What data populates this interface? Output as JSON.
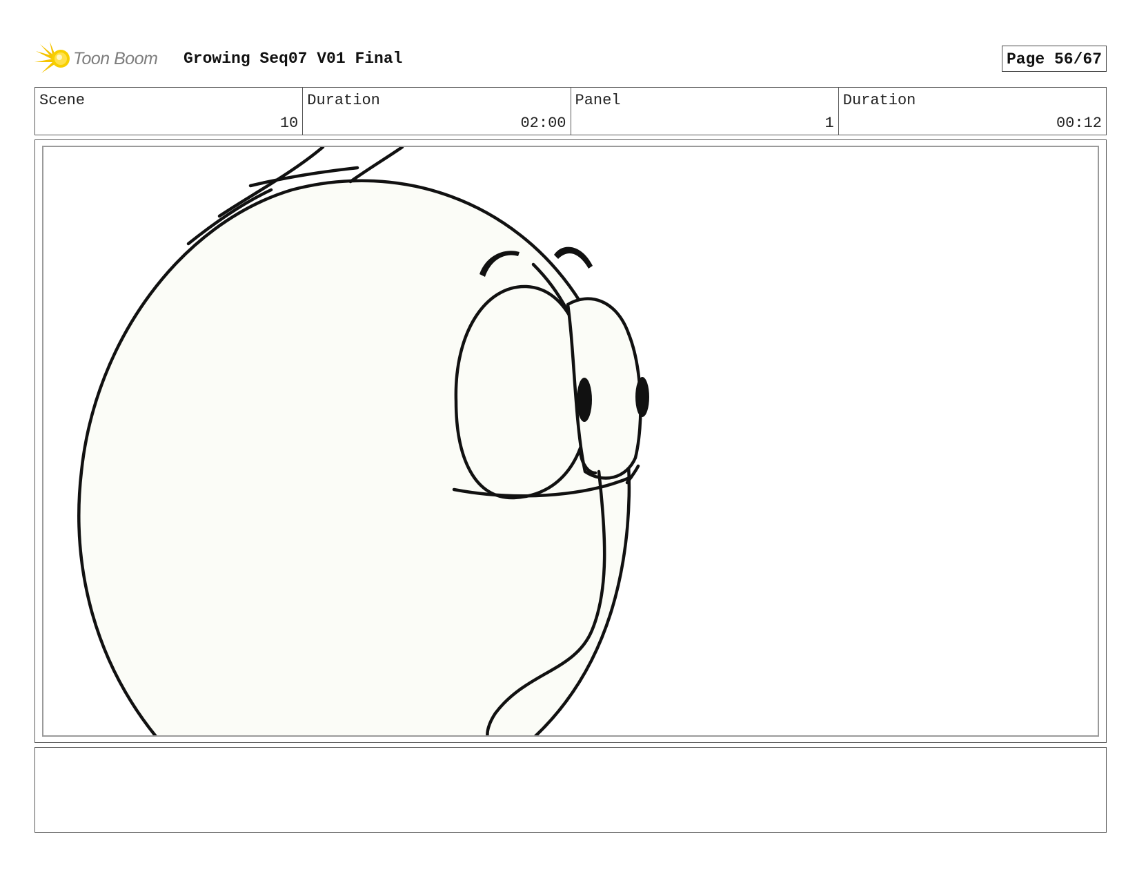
{
  "header": {
    "logo_text": "Toon Boom",
    "title": "Growing Seq07 V01 Final",
    "page_label": "Page 56/67"
  },
  "info": {
    "scene_label": "Scene",
    "scene_value": "10",
    "scene_duration_label": "Duration",
    "scene_duration_value": "02:00",
    "panel_label": "Panel",
    "panel_value": "1",
    "panel_duration_label": "Duration",
    "panel_duration_value": "00:12"
  },
  "notes": {
    "text": ""
  },
  "colors": {
    "logo_flare": "#f5c400",
    "logo_text": "#7d7d7d",
    "character_fill": "#fbfcf7",
    "line": "#111111",
    "frame_border": "#555555",
    "inner_border": "#9a9a9a"
  },
  "icons": {
    "logo": "toon-boom-flare-icon"
  }
}
